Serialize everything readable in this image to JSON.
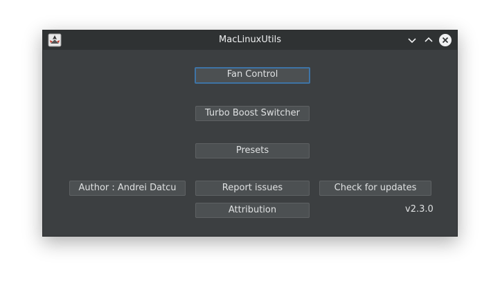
{
  "window": {
    "title": "MacLinuxUtils"
  },
  "titlebar": {
    "buttons": [
      "minimize-icon",
      "maximize-icon",
      "close-icon"
    ]
  },
  "main": {
    "fan_control_label": "Fan Control",
    "turbo_boost_label": "Turbo Boost Switcher",
    "presets_label": "Presets",
    "author_label": "Author : Andrei Datcu",
    "report_issues_label": "Report issues",
    "check_updates_label": "Check for updates",
    "attribution_label": "Attribution",
    "version": "v2.3.0"
  },
  "colors": {
    "window_bg": "#3c3f41",
    "titlebar_bg": "#2f3233",
    "button_bg": "#4c5052",
    "focus_border": "#3e74a6",
    "text": "#dfe1e2"
  }
}
